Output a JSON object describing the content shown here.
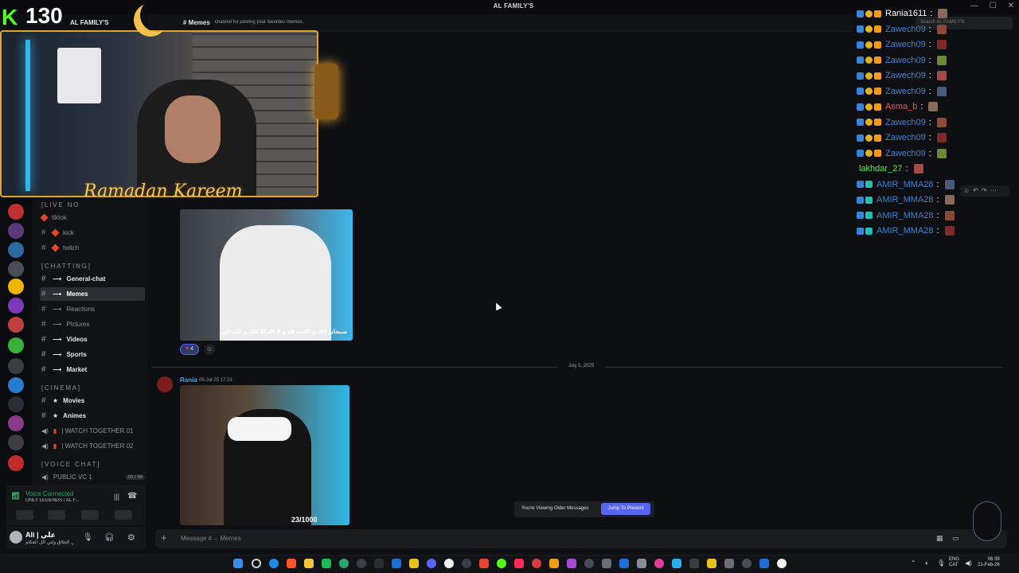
{
  "app": {
    "server_title": "AL FAMILY'S",
    "server_tag": "AL FAMILY'S"
  },
  "stream": {
    "kick_logo_letter": "K",
    "viewer_count": "130",
    "overlay_text": "Ramadan Kareem"
  },
  "channel_header": {
    "name": "Memes",
    "topic": "channel for posting your favorites memes."
  },
  "search": {
    "placeholder": "Search AL FAMILY'S"
  },
  "sidebar": {
    "cat_live": "[LIVE NO",
    "cat_chatting": "[CHATTING]",
    "cat_cinema": "[CINEMA]",
    "cat_voice": "[VOICE CHAT]",
    "live_channels": [
      "tiktok",
      "kick",
      "twitch"
    ],
    "text_channels": [
      "General-chat",
      "Memes",
      "Reactions",
      "Pictures",
      "Videos",
      "Sports",
      "Market"
    ],
    "cinema_channels": [
      "Movies",
      "Animes",
      "| WATCH TOGETHER 01",
      "| WATCH TOGETHER 02"
    ],
    "voice_channel": "PUBLIC VC 1",
    "voice_counts": "00 / 98"
  },
  "voice": {
    "status": "Voice Connected",
    "sub": "ONLY LEGENDS / AL F..."
  },
  "user": {
    "name": "Ali | علي",
    "status": "علي الخلاق ولتي الل العكام"
  },
  "messages": {
    "reaction_count": "4",
    "date_divider": "July 5, 2025",
    "author": "Rania",
    "timestamp": "05-Jul-25 17:23",
    "image1_caption": "سبحان الله و الكمة لله و لا اله الا الله و الله اكبر",
    "image2_counter": "23/1000"
  },
  "older": {
    "text": "You're Viewing Older Messages",
    "button": "Jump To Present"
  },
  "composer": {
    "placeholder": "Message #→ Memes"
  },
  "chat": [
    {
      "user": "Rania1611",
      "color": "#ffffff",
      "badges": [
        "blue",
        "gold",
        "orange"
      ]
    },
    {
      "user": "Zawech09",
      "color": "#3a84d8",
      "badges": [
        "blue",
        "gold",
        "orange"
      ]
    },
    {
      "user": "Zawech09",
      "color": "#3a84d8",
      "badges": [
        "blue",
        "gold",
        "orange"
      ]
    },
    {
      "user": "Zawech09",
      "color": "#3a84d8",
      "badges": [
        "blue",
        "gold",
        "orange"
      ]
    },
    {
      "user": "Zawech09",
      "color": "#3a84d8",
      "badges": [
        "blue",
        "gold",
        "orange"
      ]
    },
    {
      "user": "Zawech09",
      "color": "#3a84d8",
      "badges": [
        "blue",
        "gold",
        "orange"
      ]
    },
    {
      "user": "Asma_b",
      "color": "#e0566e",
      "badges": [
        "blue",
        "gold",
        "orange"
      ]
    },
    {
      "user": "Zawech09",
      "color": "#3a84d8",
      "badges": [
        "blue",
        "gold",
        "orange"
      ]
    },
    {
      "user": "Zawech09",
      "color": "#3a84d8",
      "badges": [
        "blue",
        "gold",
        "orange"
      ]
    },
    {
      "user": "Zawech09",
      "color": "#3a84d8",
      "badges": [
        "blue",
        "gold",
        "orange"
      ]
    },
    {
      "user": "lakhdar_27",
      "color": "#67e04a",
      "badges": []
    },
    {
      "user": "AMIR_MMA28",
      "color": "#3a84d8",
      "badges": [
        "blue",
        "teal"
      ]
    },
    {
      "user": "AMIR_MMA28",
      "color": "#3a84d8",
      "badges": [
        "blue",
        "teal"
      ]
    },
    {
      "user": "AMIR_MMA28",
      "color": "#3a84d8",
      "badges": [
        "blue",
        "teal"
      ]
    },
    {
      "user": "AMIR_MMA28",
      "color": "#3a84d8",
      "badges": [
        "blue",
        "teal"
      ]
    }
  ],
  "taskbar": {
    "lang1": "ENG",
    "lang2": "CAT",
    "time": "06:39",
    "date": "21-Feb-26"
  },
  "colors": {
    "accent": "#5865f2",
    "kick_green": "#53fc18",
    "gold": "#e0a528"
  }
}
